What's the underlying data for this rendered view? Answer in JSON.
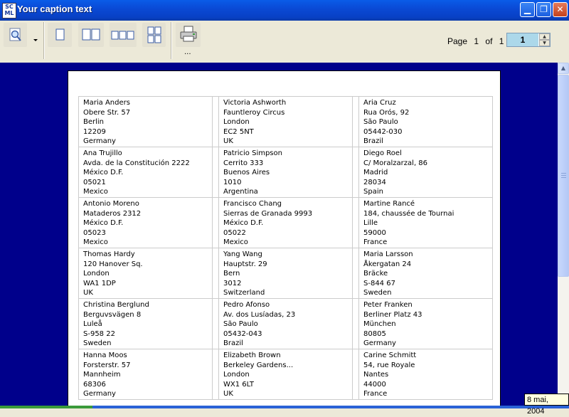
{
  "window": {
    "title": "Your caption text",
    "icon_text": "SC ML"
  },
  "toolbar": {
    "print_caption": "...",
    "page_word": "Page",
    "page_current": "1",
    "of_word": "of",
    "page_total": "1",
    "page_input_value": "1"
  },
  "labels": [
    [
      [
        "Maria Anders",
        "Obere Str. 57",
        "Berlin",
        "12209",
        "Germany"
      ],
      [
        "Victoria Ashworth",
        "Fauntleroy Circus",
        "London",
        "EC2 5NT",
        "UK"
      ],
      [
        "Aria Cruz",
        "Rua Orós, 92",
        "São Paulo",
        "05442-030",
        "Brazil"
      ]
    ],
    [
      [
        "Ana Trujillo",
        "Avda. de la Constitución 2222",
        "México D.F.",
        "05021",
        "Mexico"
      ],
      [
        "Patricio Simpson",
        "Cerrito 333",
        "Buenos Aires",
        "1010",
        "Argentina"
      ],
      [
        "Diego Roel",
        "C/ Moralzarzal, 86",
        "Madrid",
        "28034",
        "Spain"
      ]
    ],
    [
      [
        "Antonio Moreno",
        "Mataderos  2312",
        "México D.F.",
        "05023",
        "Mexico"
      ],
      [
        "Francisco Chang",
        "Sierras de Granada 9993",
        "México D.F.",
        "05022",
        "Mexico"
      ],
      [
        "Martine Rancé",
        "184, chaussée de Tournai",
        "Lille",
        "59000",
        "France"
      ]
    ],
    [
      [
        "Thomas Hardy",
        "120 Hanover Sq.",
        "London",
        "WA1 1DP",
        "UK"
      ],
      [
        "Yang Wang",
        "Hauptstr. 29",
        "Bern",
        "3012",
        "Switzerland"
      ],
      [
        "Maria Larsson",
        "Åkergatan 24",
        "Bräcke",
        "S-844 67",
        "Sweden"
      ]
    ],
    [
      [
        "Christina Berglund",
        "Berguvsvägen  8",
        "Luleå",
        "S-958 22",
        "Sweden"
      ],
      [
        "Pedro Afonso",
        "Av. dos Lusíadas, 23",
        "São Paulo",
        "05432-043",
        "Brazil"
      ],
      [
        "Peter Franken",
        "Berliner Platz 43",
        "München",
        "80805",
        "Germany"
      ]
    ],
    [
      [
        "Hanna Moos",
        "Forsterstr. 57",
        "Mannheim",
        "68306",
        "Germany"
      ],
      [
        "Elizabeth Brown",
        "Berkeley Gardens...",
        "London",
        "WX1 6LT",
        "UK"
      ],
      [
        "Carine Schmitt",
        "54, rue Royale",
        "Nantes",
        "44000",
        "France"
      ]
    ]
  ],
  "status": {
    "date": "8 mai, 2004"
  },
  "colors": {
    "preview_bg": "#00008b",
    "titlebar": "#0a4ad6",
    "page_input_bg": "#acd8ea"
  }
}
